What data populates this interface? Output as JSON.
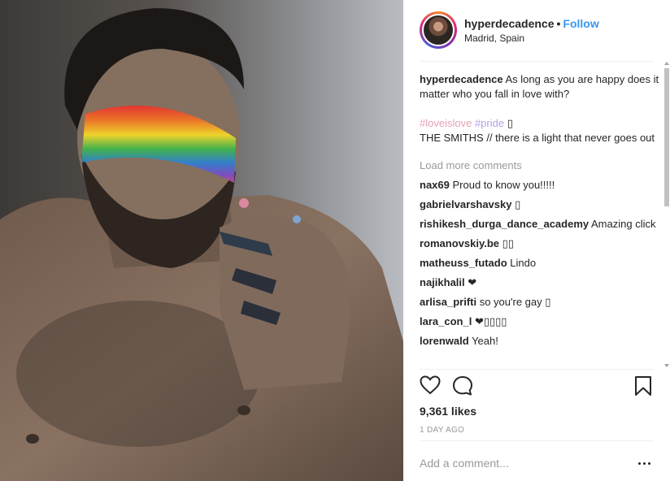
{
  "header": {
    "username": "hyperdecadence",
    "separator": "•",
    "follow_label": "Follow",
    "location": "Madrid, Spain"
  },
  "caption": {
    "username": "hyperdecadence",
    "text": "As long as you are happy does it matter who you fall in love with?",
    "tag_love": "#loveislove",
    "tag_pride": "#pride",
    "tag_emoji": "▯",
    "line2": "THE SMITHS // there is a light that never goes out"
  },
  "load_more_label": "Load more comments",
  "comments": [
    {
      "user": "nax69",
      "text": "Proud to know you!!!!!"
    },
    {
      "user": "gabrielvarshavsky",
      "text": "▯"
    },
    {
      "user": "rishikesh_durga_dance_academy",
      "text": "Amazing click"
    },
    {
      "user": "romanovskiy.be",
      "text": "▯▯"
    },
    {
      "user": "matheuss_futado",
      "text": "Lindo"
    },
    {
      "user": "najikhalil",
      "text": "❤"
    },
    {
      "user": "arlisa_prifti",
      "text": "so you're gay ▯"
    },
    {
      "user": "lara_con_l",
      "text": "❤▯▯▯▯"
    },
    {
      "user": "lorenwald",
      "text": "Yeah!"
    }
  ],
  "icons": {
    "like": "heart-icon",
    "comment": "comment-icon",
    "save": "bookmark-icon",
    "more": "more-options-icon"
  },
  "likes": "9,361 likes",
  "timestamp": "1 DAY AGO",
  "add_comment_placeholder": "Add a comment...",
  "colors": {
    "link": "#3897f0",
    "muted": "#999999",
    "text": "#262626",
    "tag_love": "#e39fb7",
    "tag_pride": "#b7a0e5"
  }
}
